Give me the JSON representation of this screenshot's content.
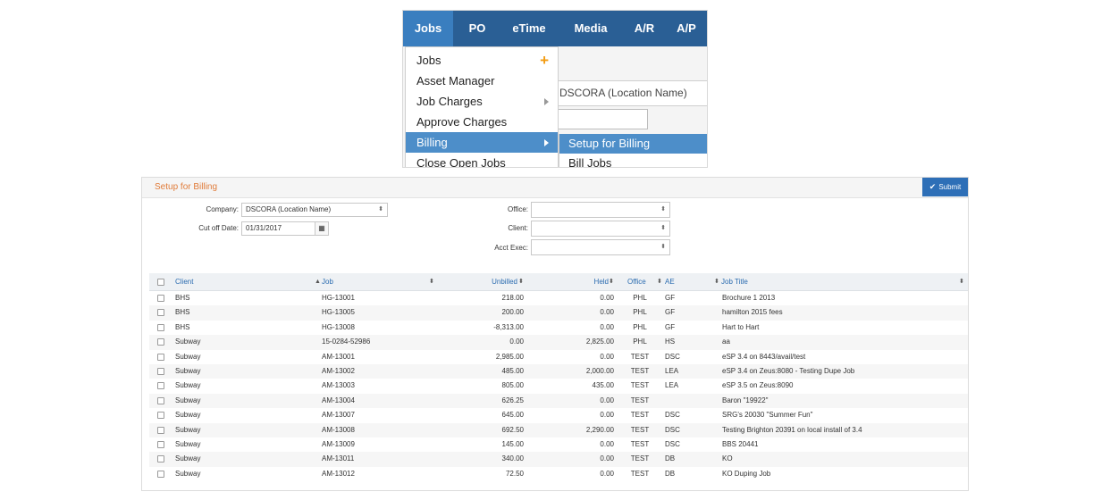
{
  "navbar": {
    "tabs": [
      "Jobs",
      "PO",
      "eTime",
      "Media",
      "A/R",
      "A/P"
    ]
  },
  "jobs_menu": {
    "items": [
      "Jobs",
      "Asset Manager",
      "Job Charges",
      "Approve Charges",
      "Billing",
      "Close Open Jobs"
    ],
    "add_icon": "+"
  },
  "billing_submenu": {
    "items": [
      "Setup for Billing",
      "Bill Jobs"
    ]
  },
  "background_field": "DSCORA (Location Name)",
  "panel": {
    "title": "Setup for Billing",
    "submit_label": "Submit"
  },
  "filters": {
    "company_label": "Company:",
    "company_value": "DSCORA (Location Name)",
    "cutoff_label": "Cut off Date:",
    "cutoff_value": "01/31/2017",
    "office_label": "Office:",
    "client_label": "Client:",
    "acct_exec_label": "Acct Exec:"
  },
  "table": {
    "columns": [
      "Client",
      "Job",
      "Unbilled",
      "Held",
      "Office",
      "AE",
      "Job Title"
    ],
    "rows": [
      [
        "BHS",
        "HG-13001",
        "218.00",
        "0.00",
        "PHL",
        "GF",
        "Brochure 1 2013"
      ],
      [
        "BHS",
        "HG-13005",
        "200.00",
        "0.00",
        "PHL",
        "GF",
        "hamilton 2015 fees"
      ],
      [
        "BHS",
        "HG-13008",
        "-8,313.00",
        "0.00",
        "PHL",
        "GF",
        "Hart to Hart"
      ],
      [
        "Subway",
        "15-0284-52986",
        "0.00",
        "2,825.00",
        "PHL",
        "HS",
        "aa"
      ],
      [
        "Subway",
        "AM-13001",
        "2,985.00",
        "0.00",
        "TEST",
        "DSC",
        "eSP 3.4 on 8443/avail/test"
      ],
      [
        "Subway",
        "AM-13002",
        "485.00",
        "2,000.00",
        "TEST",
        "LEA",
        "eSP 3.4 on Zeus:8080 - Testing Dupe Job"
      ],
      [
        "Subway",
        "AM-13003",
        "805.00",
        "435.00",
        "TEST",
        "LEA",
        "eSP 3.5 on Zeus:8090"
      ],
      [
        "Subway",
        "AM-13004",
        "626.25",
        "0.00",
        "TEST",
        "",
        "Baron \"19922\""
      ],
      [
        "Subway",
        "AM-13007",
        "645.00",
        "0.00",
        "TEST",
        "DSC",
        "SRG's 20030 \"Summer Fun\""
      ],
      [
        "Subway",
        "AM-13008",
        "692.50",
        "2,290.00",
        "TEST",
        "DSC",
        "Testing Brighton 20391 on local install of 3.4"
      ],
      [
        "Subway",
        "AM-13009",
        "145.00",
        "0.00",
        "TEST",
        "DSC",
        "BBS 20441"
      ],
      [
        "Subway",
        "AM-13011",
        "340.00",
        "0.00",
        "TEST",
        "DB",
        "KO"
      ],
      [
        "Subway",
        "AM-13012",
        "72.50",
        "0.00",
        "TEST",
        "DB",
        "KO Duping Job"
      ]
    ]
  },
  "icons": {
    "check": "check-icon",
    "calendar": "calendar-icon",
    "sort": "sort-icon",
    "caret": "select-caret-icon",
    "submenu_arrow": "chevron-right-icon"
  },
  "colors": {
    "navbar": "#2a5f95",
    "active_tab": "#3a7ebf",
    "highlight": "#4d8ec9",
    "title_orange": "#e07b39",
    "submit_blue": "#2e6fb7",
    "link_blue": "#2b6cb0"
  }
}
